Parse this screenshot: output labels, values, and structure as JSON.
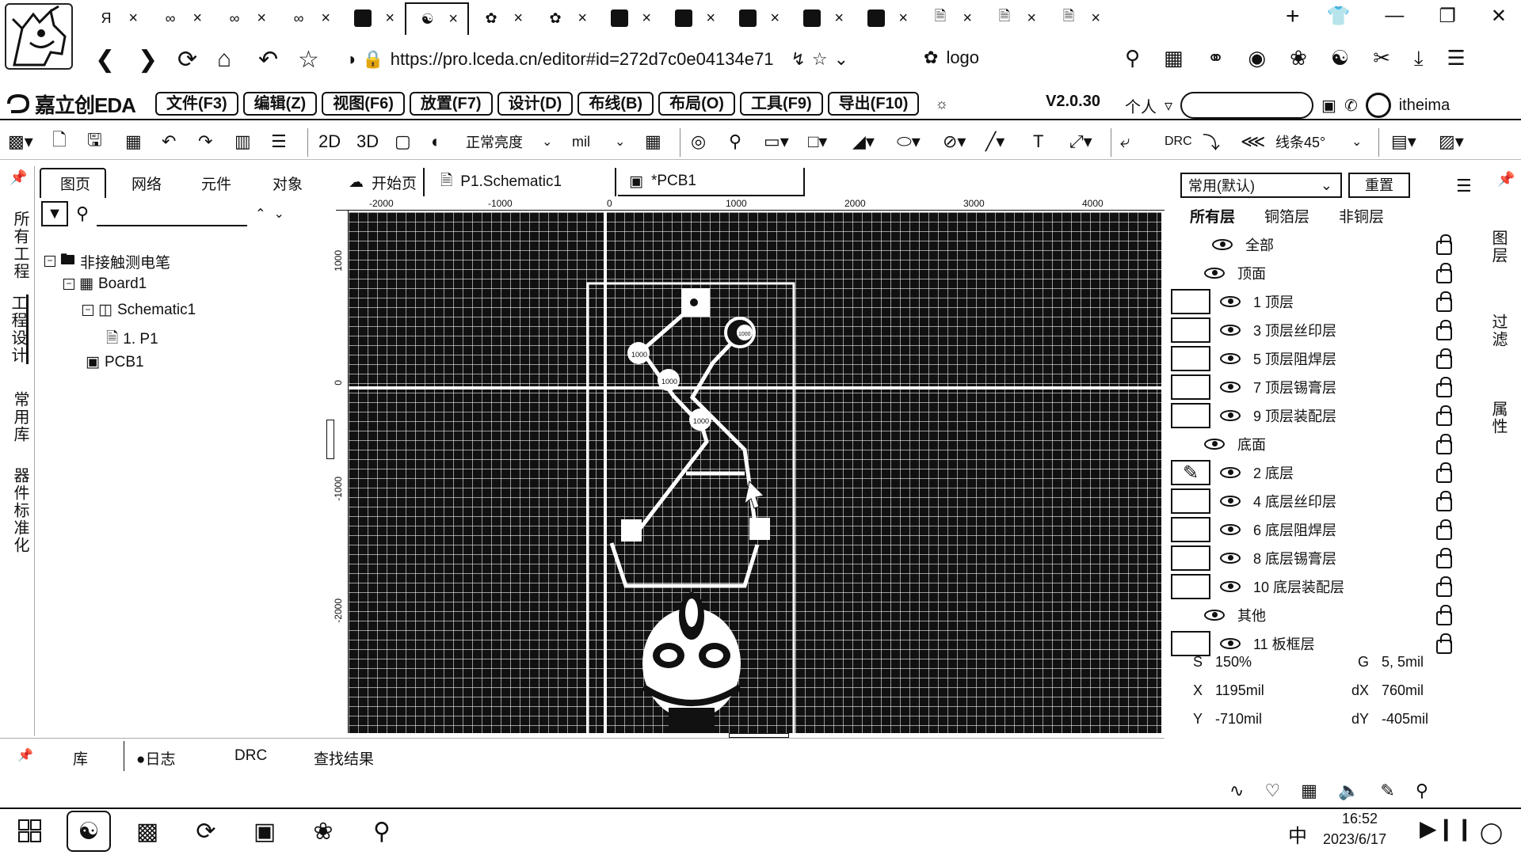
{
  "browser": {
    "tabs": [
      {
        "icon": "hook-icon",
        "title": "",
        "active": false
      },
      {
        "icon": "link-icon",
        "title": "",
        "active": false
      },
      {
        "icon": "link-icon",
        "title": "",
        "active": false
      },
      {
        "icon": "link-icon",
        "title": "",
        "active": false
      },
      {
        "icon": "box-icon",
        "title": "",
        "active": false
      },
      {
        "icon": "lceda-icon",
        "title": "",
        "active": true
      },
      {
        "icon": "paw-icon",
        "title": "",
        "active": false
      },
      {
        "icon": "paw-icon",
        "title": "",
        "active": false
      },
      {
        "icon": "jlc-icon",
        "title": "",
        "active": false
      },
      {
        "icon": "jlc-icon",
        "title": "",
        "active": false
      },
      {
        "icon": "jlc-icon",
        "title": "",
        "active": false
      },
      {
        "icon": "jlc-icon",
        "title": "",
        "active": false
      },
      {
        "icon": "box-icon",
        "title": "",
        "active": false
      },
      {
        "icon": "doc-icon",
        "title": "",
        "active": false
      },
      {
        "icon": "doc-icon",
        "title": "",
        "active": false
      },
      {
        "icon": "doc-icon",
        "title": "",
        "active": false
      }
    ],
    "url": "https://pro.lceda.cn/editor#id=272d7c0e04134e71",
    "bookmark_label": "logo",
    "new_tab": "+"
  },
  "app": {
    "brand": "嘉立创EDA",
    "menus": [
      "文件(F3)",
      "编辑(Z)",
      "视图(F6)",
      "放置(F7)",
      "设计(D)",
      "布线(B)",
      "布局(O)",
      "工具(F9)",
      "导出(F10)"
    ],
    "version": "V2.0.30",
    "user_mode": "个人",
    "user_name": "itheima"
  },
  "toolbar": {
    "view_2d": "2D",
    "view_3d": "3D",
    "brightness": "正常亮度",
    "unit": "mil",
    "drc": "DRC",
    "route_angle": "线条45°"
  },
  "left_rail": {
    "tabs": [
      "所有工程",
      "工程设计",
      "常用库",
      "器件标准化"
    ]
  },
  "left_panel": {
    "tabs": [
      "图页",
      "网络",
      "元件",
      "对象"
    ],
    "search_placeholder": "",
    "tree": [
      {
        "label": "非接触测电笔",
        "level": 0,
        "icon": "folder-icon"
      },
      {
        "label": "Board1",
        "level": 1,
        "icon": "board-icon"
      },
      {
        "label": "Schematic1",
        "level": 2,
        "icon": "schematic-icon"
      },
      {
        "label": "1. P1",
        "level": 3,
        "icon": "page-icon"
      },
      {
        "label": "PCB1",
        "level": 2,
        "icon": "pcb-icon"
      }
    ]
  },
  "doc_tabs": [
    {
      "label": "开始页",
      "icon": "home-cloud-icon"
    },
    {
      "label": "P1.Schematic1",
      "icon": "page-icon"
    },
    {
      "label": "*PCB1",
      "icon": "pcb-icon"
    }
  ],
  "canvas": {
    "ruler_h": [
      "-2000",
      "-1000",
      "0",
      "1000",
      "2000",
      "3000",
      "4000"
    ],
    "ruler_v": [
      "1000",
      "0",
      "-1000",
      "-2000"
    ],
    "component_labels": [
      "1000",
      "1000",
      "1000",
      "1000"
    ]
  },
  "right_panel": {
    "preset": "常用(默认)",
    "reset": "重置",
    "layer_tabs": [
      "所有层",
      "铜箔层",
      "非铜层"
    ],
    "layers": [
      {
        "label": "全部",
        "type": "group-all"
      },
      {
        "label": "顶面",
        "type": "group"
      },
      {
        "label": "1 顶层",
        "type": "layer"
      },
      {
        "label": "3 顶层丝印层",
        "type": "layer"
      },
      {
        "label": "5 顶层阻焊层",
        "type": "layer"
      },
      {
        "label": "7 顶层锡膏层",
        "type": "layer"
      },
      {
        "label": "9 顶层装配层",
        "type": "layer"
      },
      {
        "label": "底面",
        "type": "group"
      },
      {
        "label": "2 底层",
        "type": "layer-active"
      },
      {
        "label": "4 底层丝印层",
        "type": "layer"
      },
      {
        "label": "6 底层阻焊层",
        "type": "layer"
      },
      {
        "label": "8 底层锡膏层",
        "type": "layer"
      },
      {
        "label": "10 底层装配层",
        "type": "layer"
      },
      {
        "label": "其他",
        "type": "group"
      },
      {
        "label": "11 板框层",
        "type": "layer"
      }
    ],
    "side_tabs": [
      "图层",
      "过滤",
      "属性"
    ]
  },
  "status": {
    "s_label": "S",
    "s_value": "150%",
    "g_label": "G",
    "g_value": "5, 5mil",
    "x_label": "X",
    "x_value": "1195mil",
    "dx_label": "dX",
    "dx_value": "760mil",
    "y_label": "Y",
    "y_value": "-710mil",
    "dy_label": "dY",
    "dy_value": "-405mil"
  },
  "bottom_panel": {
    "tabs": [
      "库",
      "日志",
      "DRC",
      "查找结果"
    ]
  },
  "taskbar": {
    "clock_time": "16:52",
    "clock_date": "2023/6/17",
    "ime": "中"
  }
}
